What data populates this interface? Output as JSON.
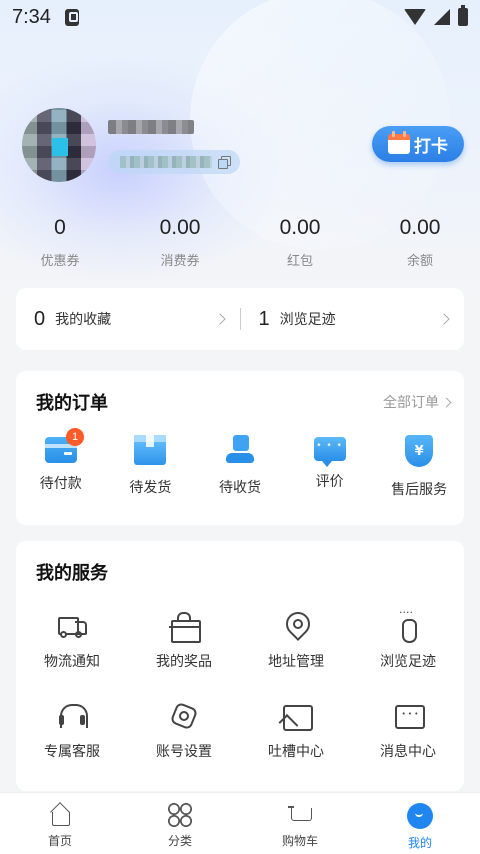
{
  "status_bar": {
    "time": "7:34"
  },
  "profile": {
    "checkin_label": "打卡"
  },
  "stats": [
    {
      "value": "0",
      "label": "优惠券"
    },
    {
      "value": "0.00",
      "label": "消费券"
    },
    {
      "value": "0.00",
      "label": "红包"
    },
    {
      "value": "0.00",
      "label": "余额"
    }
  ],
  "favorites": {
    "collect_count": "0",
    "collect_label": "我的收藏",
    "history_count": "1",
    "history_label": "浏览足迹"
  },
  "orders": {
    "title": "我的订单",
    "all_label": "全部订单",
    "items": [
      {
        "label": "待付款",
        "icon": "wallet-icon",
        "badge": "1"
      },
      {
        "label": "待发货",
        "icon": "box-icon"
      },
      {
        "label": "待收货",
        "icon": "receive-icon"
      },
      {
        "label": "评价",
        "icon": "comment-icon"
      },
      {
        "label": "售后服务",
        "icon": "shield-icon",
        "glyph": "¥"
      }
    ]
  },
  "services": {
    "title": "我的服务",
    "items": [
      {
        "label": "物流通知",
        "icon": "truck-icon"
      },
      {
        "label": "我的奖品",
        "icon": "gift-icon"
      },
      {
        "label": "地址管理",
        "icon": "location-icon"
      },
      {
        "label": "浏览足迹",
        "icon": "footprint-icon"
      },
      {
        "label": "专属客服",
        "icon": "headset-icon"
      },
      {
        "label": "账号设置",
        "icon": "settings-icon"
      },
      {
        "label": "吐槽中心",
        "icon": "image-icon"
      },
      {
        "label": "消息中心",
        "icon": "message-icon"
      }
    ]
  },
  "bottom_nav": [
    {
      "label": "首页",
      "icon": "home-icon"
    },
    {
      "label": "分类",
      "icon": "category-icon"
    },
    {
      "label": "购物车",
      "icon": "cart-icon"
    },
    {
      "label": "我的",
      "icon": "me-icon",
      "active": true
    }
  ],
  "colors": {
    "accent": "#1f86f0",
    "badge": "#ff5a2a",
    "background": "#f4f5f7"
  }
}
